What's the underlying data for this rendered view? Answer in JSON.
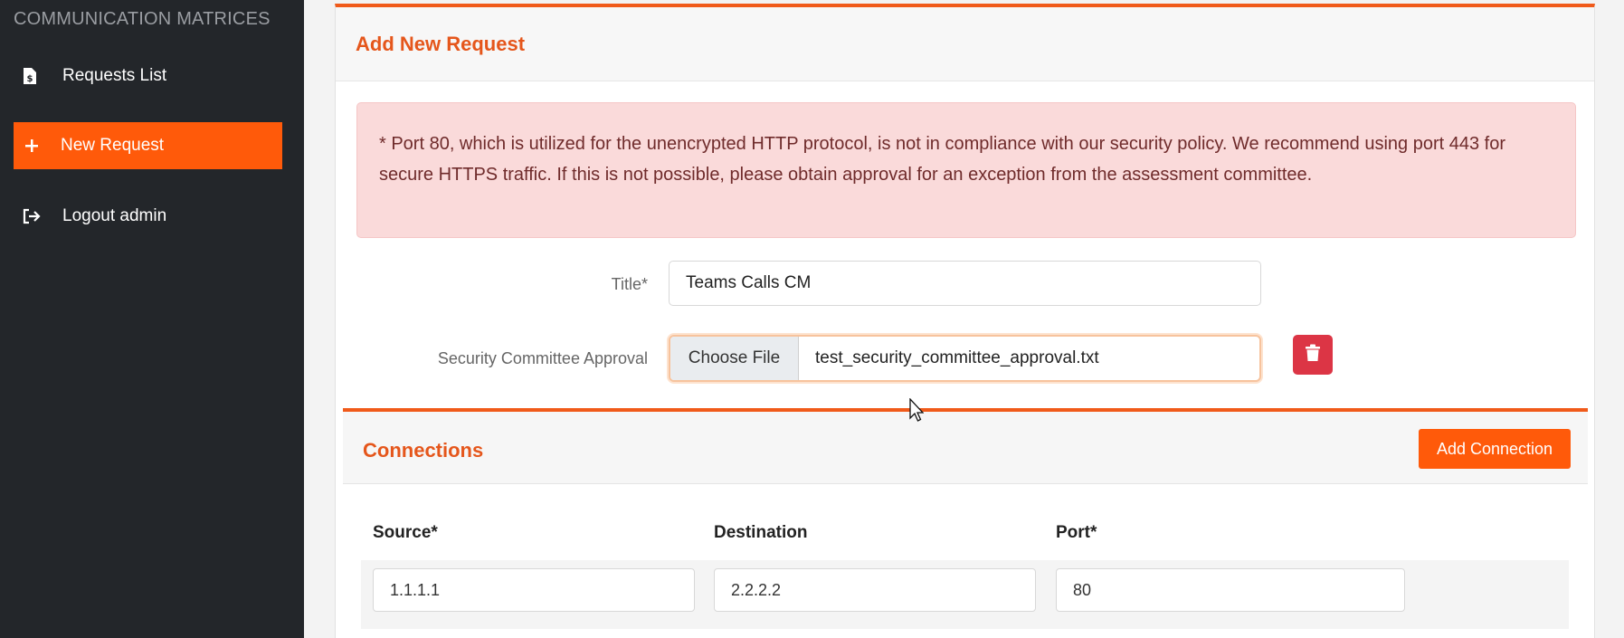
{
  "sidebar": {
    "heading": "COMMUNICATION MATRICES",
    "items": [
      {
        "label": "Requests List",
        "icon": "file-dollar-icon",
        "active": false
      },
      {
        "label": "New Request",
        "icon": "plus-icon",
        "active": true
      },
      {
        "label": "Logout admin",
        "icon": "logout-icon",
        "active": false
      }
    ]
  },
  "main": {
    "title": "Add New Request",
    "alert": "* Port 80, which is utilized for the unencrypted HTTP protocol, is not in compliance with our security policy. We recommend using port 443 for secure HTTPS traffic. If this is not possible, please obtain approval for an exception from the assessment committee.",
    "form": {
      "title_label": "Title*",
      "title_value": "Teams Calls CM",
      "approval_label": "Security Committee Approval",
      "choose_file_label": "Choose File",
      "file_name": "test_security_committee_approval.txt"
    },
    "connections": {
      "title": "Connections",
      "add_button": "Add Connection",
      "columns": [
        "Source*",
        "Destination",
        "Port*"
      ],
      "rows": [
        {
          "source": "1.1.1.1",
          "destination": "2.2.2.2",
          "port": "80"
        }
      ]
    }
  },
  "colors": {
    "accent": "#ff5a0a",
    "sidebar_bg": "#23262a",
    "alert_bg": "#fadada",
    "danger": "#dc3545"
  }
}
